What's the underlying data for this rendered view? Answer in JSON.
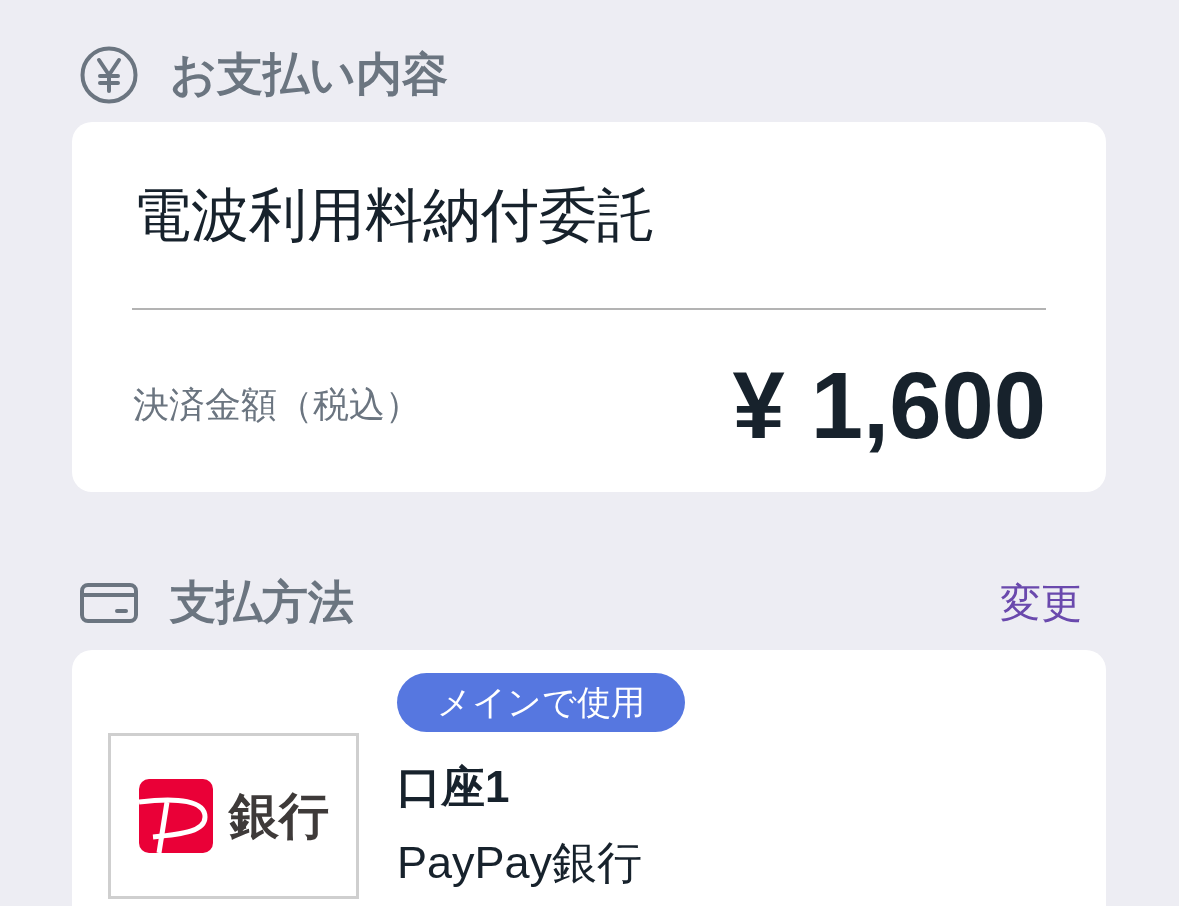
{
  "payment_details": {
    "title": "お支払い内容",
    "item_name": "電波利用料納付委託",
    "amount_label": "決済金額（税込）",
    "amount": "¥ 1,600"
  },
  "payment_method": {
    "title": "支払方法",
    "change_link": "変更",
    "account": {
      "badge": "メインで使用",
      "name": "口座1",
      "bank": "PayPay銀行",
      "logo_text": "銀行"
    }
  }
}
